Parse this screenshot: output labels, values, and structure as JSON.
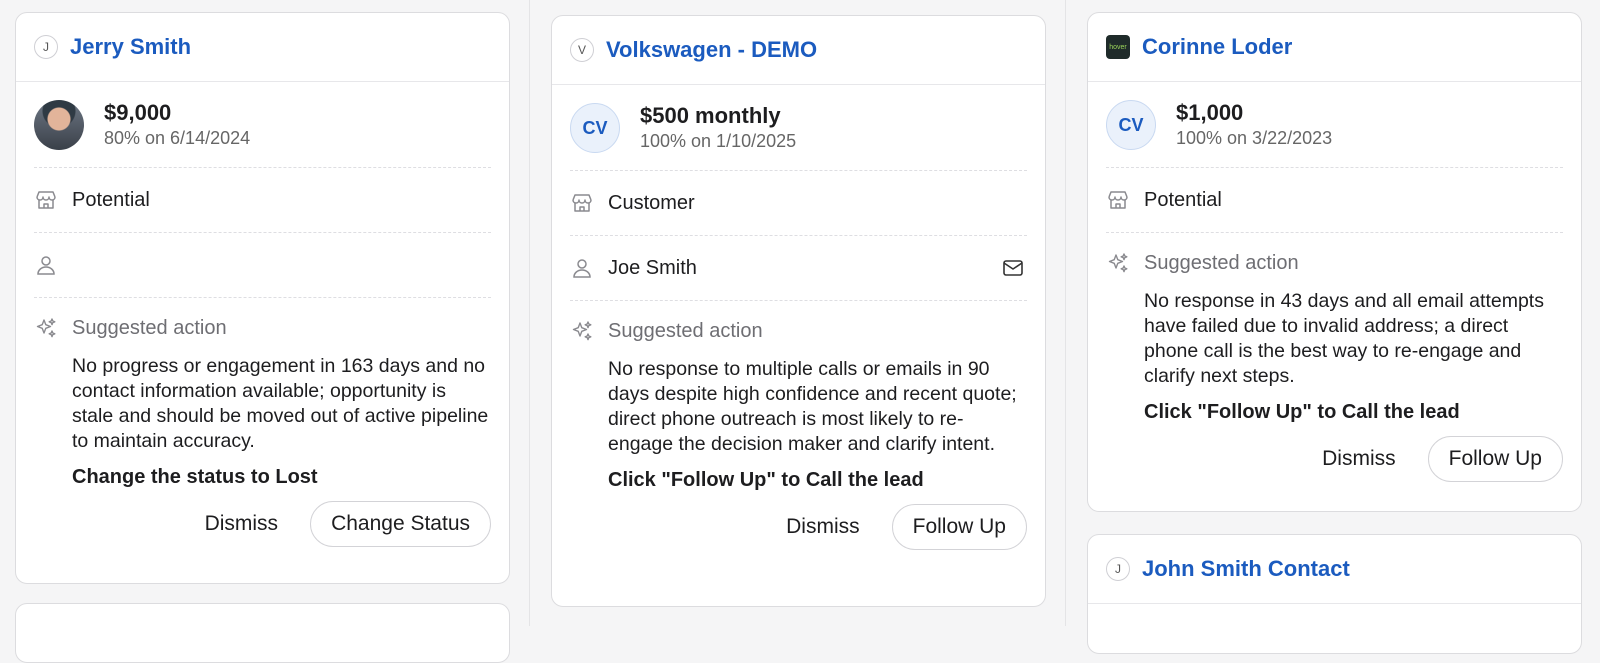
{
  "cards": [
    {
      "avatar_letter": "J",
      "title": "Jerry Smith",
      "amount": "$9,000",
      "probability": "80% on 6/14/2024",
      "status": "Potential",
      "contact": "",
      "suggest_label": "Suggested action",
      "suggest_text": "No progress or engagement in 163 days and no contact information available; opportunity is stale and should be moved out of active pipeline to maintain accuracy.",
      "suggest_cta": "Change the status to Lost",
      "dismiss_label": "Dismiss",
      "action_label": "Change Status"
    },
    {
      "avatar_letter": "V",
      "title": "Volkswagen - DEMO",
      "initials": "CV",
      "amount": "$500 monthly",
      "probability": "100% on 1/10/2025",
      "status": "Customer",
      "contact": "Joe Smith",
      "suggest_label": "Suggested action",
      "suggest_text": "No response to multiple calls or emails in 90 days despite high confidence and recent quote; direct phone outreach is most likely to re-engage the decision maker and clarify intent.",
      "suggest_cta": "Click \"Follow Up\" to Call the lead",
      "dismiss_label": "Dismiss",
      "action_label": "Follow Up"
    },
    {
      "logo_text": "hover",
      "title": "Corinne Loder",
      "initials": "CV",
      "amount": "$1,000",
      "probability": "100% on 3/22/2023",
      "status": "Potential",
      "suggest_label": "Suggested action",
      "suggest_text": "No response in 43 days and all email attempts have failed due to invalid address; a direct phone call is the best way to re-engage and clarify next steps.",
      "suggest_cta": "Click \"Follow Up\" to Call the lead",
      "dismiss_label": "Dismiss",
      "action_label": "Follow Up"
    },
    {
      "avatar_letter": "J",
      "title": "John Smith Contact"
    }
  ],
  "icons": {
    "status": "store-icon",
    "contact": "person-icon",
    "suggest": "sparkles-icon",
    "email": "mail-icon"
  },
  "colors": {
    "link": "#1b5bbf",
    "muted": "#6e6e73",
    "initials_bg": "#eaf1fb"
  }
}
